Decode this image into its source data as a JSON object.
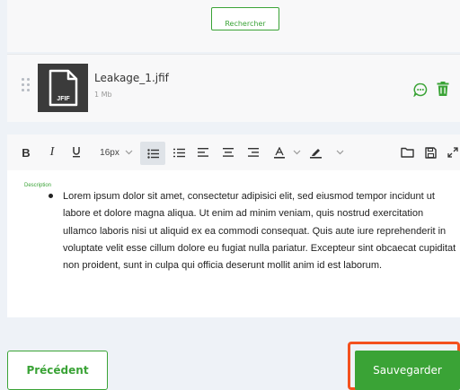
{
  "search": {
    "label": "Rechercher"
  },
  "file": {
    "name": "Leakage_1.jfif",
    "size": "1 Mb",
    "type_label": "JFIF"
  },
  "toolbar": {
    "font_size": "16px"
  },
  "editor": {
    "field_label": "Description",
    "paragraph": "Lorem ipsum dolor sit amet, consectetur adipisici elit, sed eiusmod tempor incidunt ut labore et dolore magna aliqua. Ut enim ad minim veniam, quis nostrud exercitation ullamco laboris nisi ut aliquid ex ea commodi consequat. Quis aute iure reprehenderit in voluptate velit esse cillum dolore eu fugiat nulla pariatur. Excepteur sint obcaecat cupiditat non proident, sunt in culpa qui officia deserunt mollit anim id est laborum."
  },
  "footer": {
    "prev_label": "Précédent",
    "save_label": "Sauvegarder"
  },
  "colors": {
    "accent": "#3aa336",
    "highlight": "#f4511e"
  }
}
